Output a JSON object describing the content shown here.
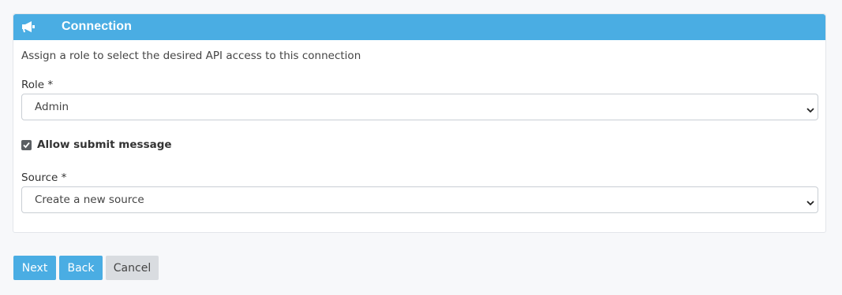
{
  "panel": {
    "title": "Connection",
    "icon": "megaphone-icon",
    "description": "Assign a role to select the desired API access to this connection"
  },
  "role": {
    "label": "Role *",
    "value": "Admin"
  },
  "allow_submit": {
    "label": "Allow submit message",
    "checked": true
  },
  "source": {
    "label": "Source *",
    "value": "Create a new source"
  },
  "buttons": {
    "next": "Next",
    "back": "Back",
    "cancel": "Cancel"
  },
  "colors": {
    "accent": "#4aade3",
    "secondary_button": "#d9dce0",
    "background": "#f7f8fa"
  }
}
